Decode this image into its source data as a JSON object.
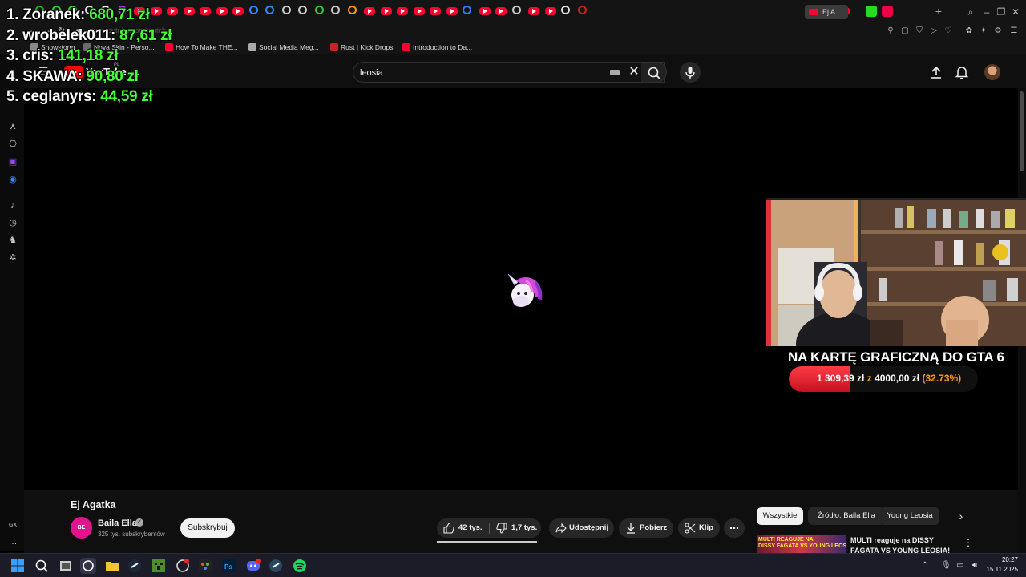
{
  "browser": {
    "url": "www.youtube.com/watch",
    "active_tab_label": "Ej A",
    "bookmarks": [
      {
        "label": "Snowstorm",
        "color": "#888888"
      },
      {
        "label": "Nova Skin - Perso...",
        "color": "#6a6a6a"
      },
      {
        "label": "How To Make THE...",
        "color": "#ff0033"
      },
      {
        "label": "Social Media Meg...",
        "color": "#aaaaaa"
      },
      {
        "label": "Rust | Kick Drops",
        "color": "#cc2222"
      },
      {
        "label": "Introduction to Da...",
        "color": "#ff0033"
      }
    ]
  },
  "leaderboard": [
    {
      "rank": "1.",
      "name": "Zoranek:",
      "amount": "680,71 zł"
    },
    {
      "rank": "2.",
      "name": "wrobelek011:",
      "amount": "87,61 zł"
    },
    {
      "rank": "3.",
      "name": "cris:",
      "amount": "141,18 zł"
    },
    {
      "rank": "4.",
      "name": "SKAWA:",
      "amount": "90,80 zł"
    },
    {
      "rank": "5.",
      "name": "ceglanyrs:",
      "amount": "44,59 zł"
    }
  ],
  "youtube": {
    "logo_text": "YouTube",
    "logo_region": "PL",
    "search_value": "leosia"
  },
  "goal": {
    "title": "NA KARTĘ GRAFICZNĄ DO GTA 6",
    "current": "1 309,39 zł",
    "of": "z",
    "target": "4000,00 zł",
    "percent_label": "(32.73%)",
    "fraction": 0.3273,
    "fill_color": "#e02030"
  },
  "video": {
    "title": "Ej Agatka",
    "channel_name": "Baila Ella",
    "channel_avatar_text": "BE",
    "subscribers": "325 tys. subskrybentów",
    "subscribe_label": "Subskrybuj",
    "likes": "42 tys.",
    "dislikes": "1,7 tys.",
    "share_label": "Udostępnij",
    "download_label": "Pobierz",
    "clip_label": "Klip",
    "like_ratio": 0.96
  },
  "chips": [
    {
      "label": "Wszystkie",
      "active": true
    },
    {
      "label": "Źródło: Baila Ella",
      "active": false
    },
    {
      "label": "Young Leosia",
      "active": false
    }
  ],
  "recommended": {
    "title": "MULTI reaguje na DISSY FAGATA VS YOUNG LEOSIA!",
    "thumb_text_1": "MULTI REAGUJE NA",
    "thumb_text_2": "DISSY FAGATA VS YOUNG LEOSIA"
  },
  "sidebar_bottom_label": "GX",
  "clock": {
    "time": "20:27",
    "date": "15.11.2025"
  }
}
